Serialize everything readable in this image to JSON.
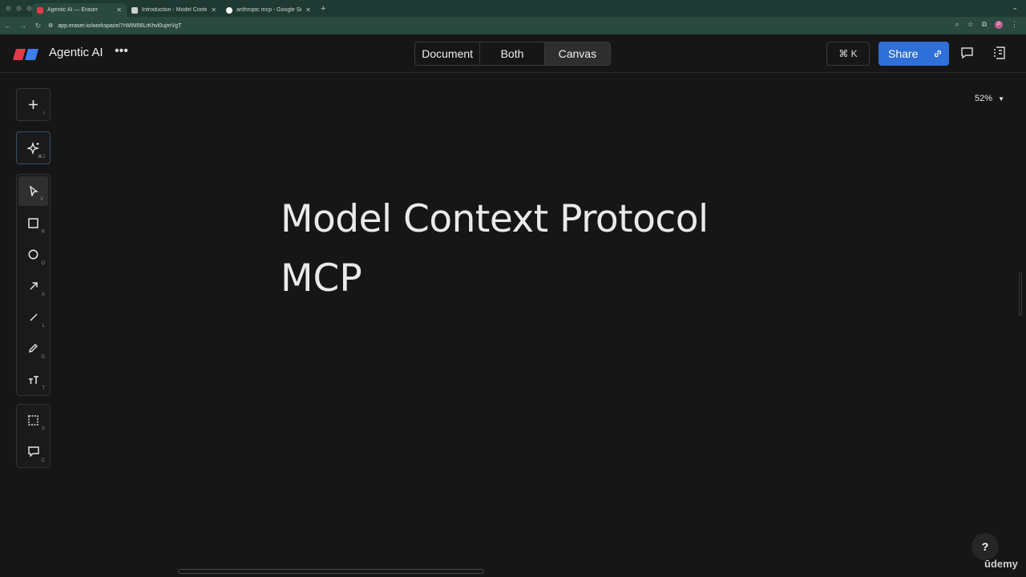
{
  "browser": {
    "tabs": [
      {
        "title": "Agentic AI — Eraser",
        "favicon_color": "#e23b4a",
        "active": true
      },
      {
        "title": "Introduction - Model Context",
        "favicon_color": "#cfcfcf",
        "active": false
      },
      {
        "title": "anthropic mcp - Google Search",
        "favicon_color": "#ffffff",
        "active": false
      }
    ],
    "new_tab": "+",
    "url": "app.eraser.io/workspace/7rWIM56LrKhvl0ujmVgT",
    "profile_initial": "P"
  },
  "header": {
    "doc_title": "Agentic AI",
    "view_modes": [
      "Document",
      "Both",
      "Canvas"
    ],
    "active_view": "Canvas",
    "command_key": "⌘ K",
    "share_label": "Share",
    "accent_color": "#2f6fd8"
  },
  "toolbar": {
    "add": {
      "icon": "plus-icon",
      "key": "/"
    },
    "ai": {
      "icon": "sparkle-icon",
      "key": "⌘J"
    },
    "tools": [
      {
        "name": "select",
        "icon": "pointer-icon",
        "key": "V"
      },
      {
        "name": "rectangle",
        "icon": "square-icon",
        "key": "R"
      },
      {
        "name": "ellipse",
        "icon": "circle-icon",
        "key": "O"
      },
      {
        "name": "arrow",
        "icon": "arrow-icon",
        "key": "A"
      },
      {
        "name": "line",
        "icon": "line-icon",
        "key": "L"
      },
      {
        "name": "draw",
        "icon": "pencil-icon",
        "key": "D"
      },
      {
        "name": "text",
        "icon": "text-icon",
        "key": "T"
      }
    ],
    "extra": [
      {
        "name": "frame",
        "icon": "frame-icon",
        "key": "F"
      },
      {
        "name": "comment",
        "icon": "comment-icon",
        "key": "C"
      }
    ]
  },
  "canvas": {
    "zoom": "52%",
    "title_line1": "Model Context Protocol",
    "title_line2": "MCP"
  },
  "help_label": "?",
  "watermark": "ūdemy"
}
